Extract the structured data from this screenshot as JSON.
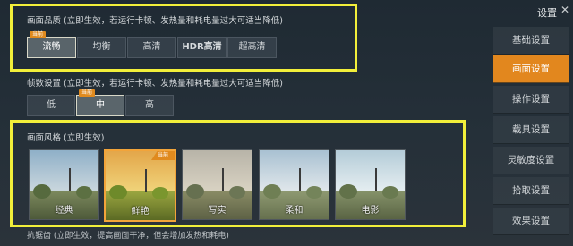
{
  "quality": {
    "title": "画面品质 (立即生效，若运行卡顿、发热量和耗电量过大可适当降低)",
    "current_tag": "当前",
    "options": [
      "流畅",
      "均衡",
      "高清",
      "HDR高清",
      "超高清"
    ]
  },
  "fps": {
    "title": "帧数设置 (立即生效，若运行卡顿、发热量和耗电量过大可适当降低)",
    "current_tag": "当前",
    "options": [
      "低",
      "中",
      "高"
    ]
  },
  "style": {
    "title": "画面风格 (立即生效)",
    "current_tag": "当前",
    "options": [
      "经典",
      "鲜艳",
      "写实",
      "柔和",
      "电影"
    ]
  },
  "antialias": {
    "text": "抗锯齿 (立即生效，提高画面干净，但会增加发热和耗电)"
  },
  "sidebar": {
    "title": "设置",
    "close_glyph": "✕",
    "items": [
      "基础设置",
      "画面设置",
      "操作设置",
      "载具设置",
      "灵敏度设置",
      "拾取设置",
      "效果设置"
    ]
  },
  "colors": {
    "accent": "#e2871e",
    "highlight": "#f2ef3a"
  }
}
